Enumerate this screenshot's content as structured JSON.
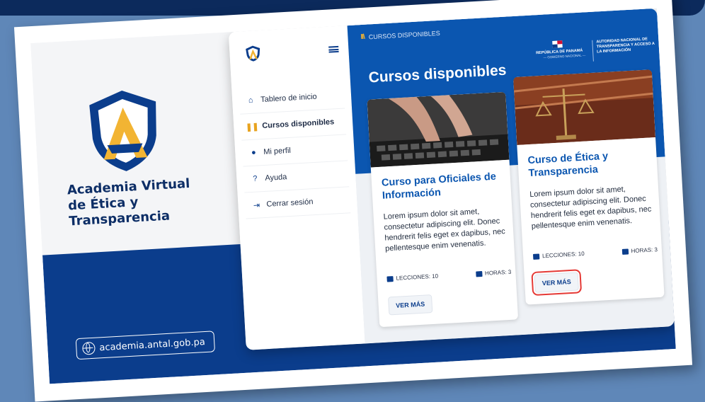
{
  "brand": {
    "title": "Academia Virtual de Ética y Transparencia",
    "url": "academia.antal.gob.pa"
  },
  "sidebar": {
    "items": [
      {
        "label": "Tablero de inicio",
        "icon": "home-icon"
      },
      {
        "label": "Cursos disponibles",
        "icon": "courses-icon",
        "active": true
      },
      {
        "label": "Mi perfil",
        "icon": "user-icon"
      },
      {
        "label": "Ayuda",
        "icon": "help-icon"
      },
      {
        "label": "Cerrar sesión",
        "icon": "logout-icon"
      }
    ]
  },
  "header": {
    "breadcrumb": "CURSOS DISPONIBLES",
    "title": "Cursos disponibles",
    "gov_line1": "REPÚBLICA DE PANAMÁ",
    "gov_line2": "— GOBIERNO NACIONAL —",
    "authority": "AUTORIDAD NACIONAL DE TRANSPARENCIA Y ACCESO A LA INFORMACIÓN"
  },
  "courses": [
    {
      "title": "Curso para Oficiales de Información",
      "description": "Lorem ipsum dolor sit amet, consectetur adipiscing elit. Donec hendrerit felis eget ex dapibus, nec pellentesque enim venenatis.",
      "lessons": "LECCIONES: 10",
      "hours": "HORAS: 3",
      "button": "VER MÁS"
    },
    {
      "title": "Curso de Ética y Transparencia",
      "description": "Lorem ipsum dolor sit amet, consectetur adipiscing elit. Donec hendrerit felis eget ex dapibus, nec pellentesque enim venenatis.",
      "lessons": "LECCIONES: 10",
      "hours": "HORAS: 3",
      "button": "VER MÁS"
    }
  ],
  "colors": {
    "navy": "#0b3d8c",
    "header_blue": "#0b56b0",
    "gold": "#f2b433",
    "highlight": "#e53935"
  }
}
